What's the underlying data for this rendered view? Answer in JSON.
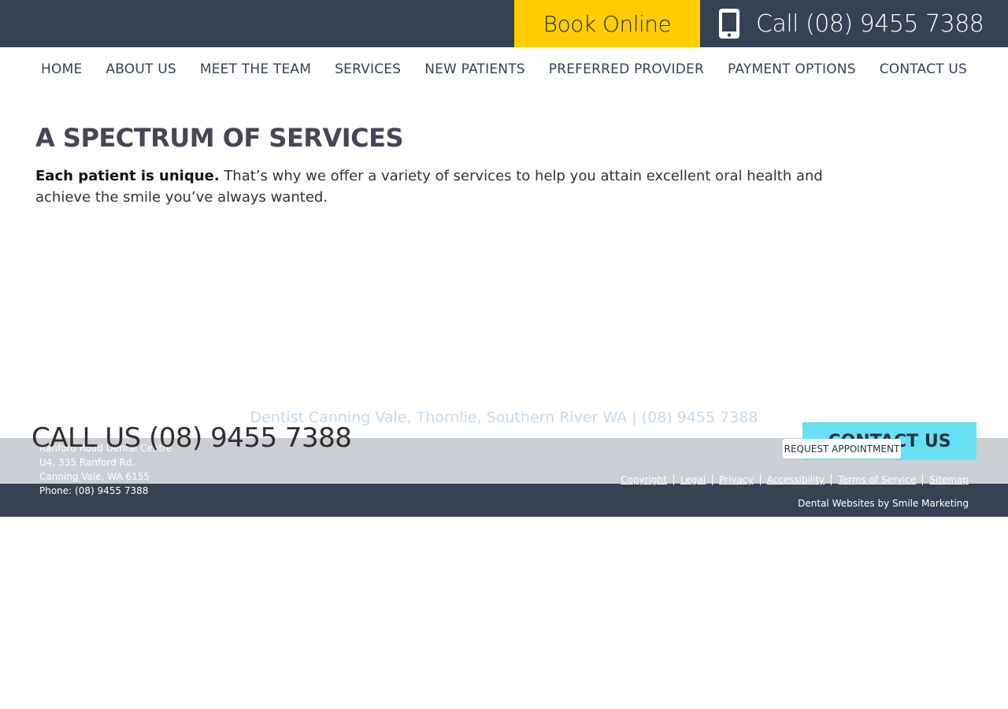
{
  "header": {
    "book_label": "Book Online",
    "call_label": "Call (08) 9455 7388"
  },
  "nav": {
    "items": [
      "HOME",
      "ABOUT US",
      "MEET THE TEAM",
      "SERVICES",
      "NEW PATIENTS",
      "PREFERRED PROVIDER",
      "PAYMENT OPTIONS",
      "CONTACT US"
    ]
  },
  "main": {
    "title": "A SPECTRUM OF SERVICES",
    "intro_bold": "Each patient is unique.",
    "intro_text": " That’s why we offer a variety of services to help you attain excellent oral health and achieve the smile you’ve always wanted."
  },
  "footer": {
    "tagline": "Dentist Canning Vale, Thornlie, Southern River WA | (08) 9455 7388",
    "call_us": "CALL US (08) 9455 7388",
    "contact_label": "CONTACT US",
    "request_label": "REQUEST APPOINTMENT",
    "address": {
      "line1": "Ranford Road Dental Centre",
      "line2": "U4, 335 Ranford Rd.",
      "line3": "Canning Vale, WA 6155",
      "line4": "Phone: (08) 9455 7388"
    },
    "links": [
      "Copyright",
      "Legal",
      "Privacy",
      "Accessibility",
      "Terms of Service",
      "Sitemap"
    ],
    "credit": "Dental Websites by Smile Marketing"
  },
  "colors": {
    "header_bg": "#364254",
    "book_bg": "#ffcd00",
    "contact_bg": "#66e0f5",
    "footer_grey": "#cbcfd4",
    "title_color": "#474556"
  },
  "icons": {
    "phone": "mobile-phone-icon"
  }
}
